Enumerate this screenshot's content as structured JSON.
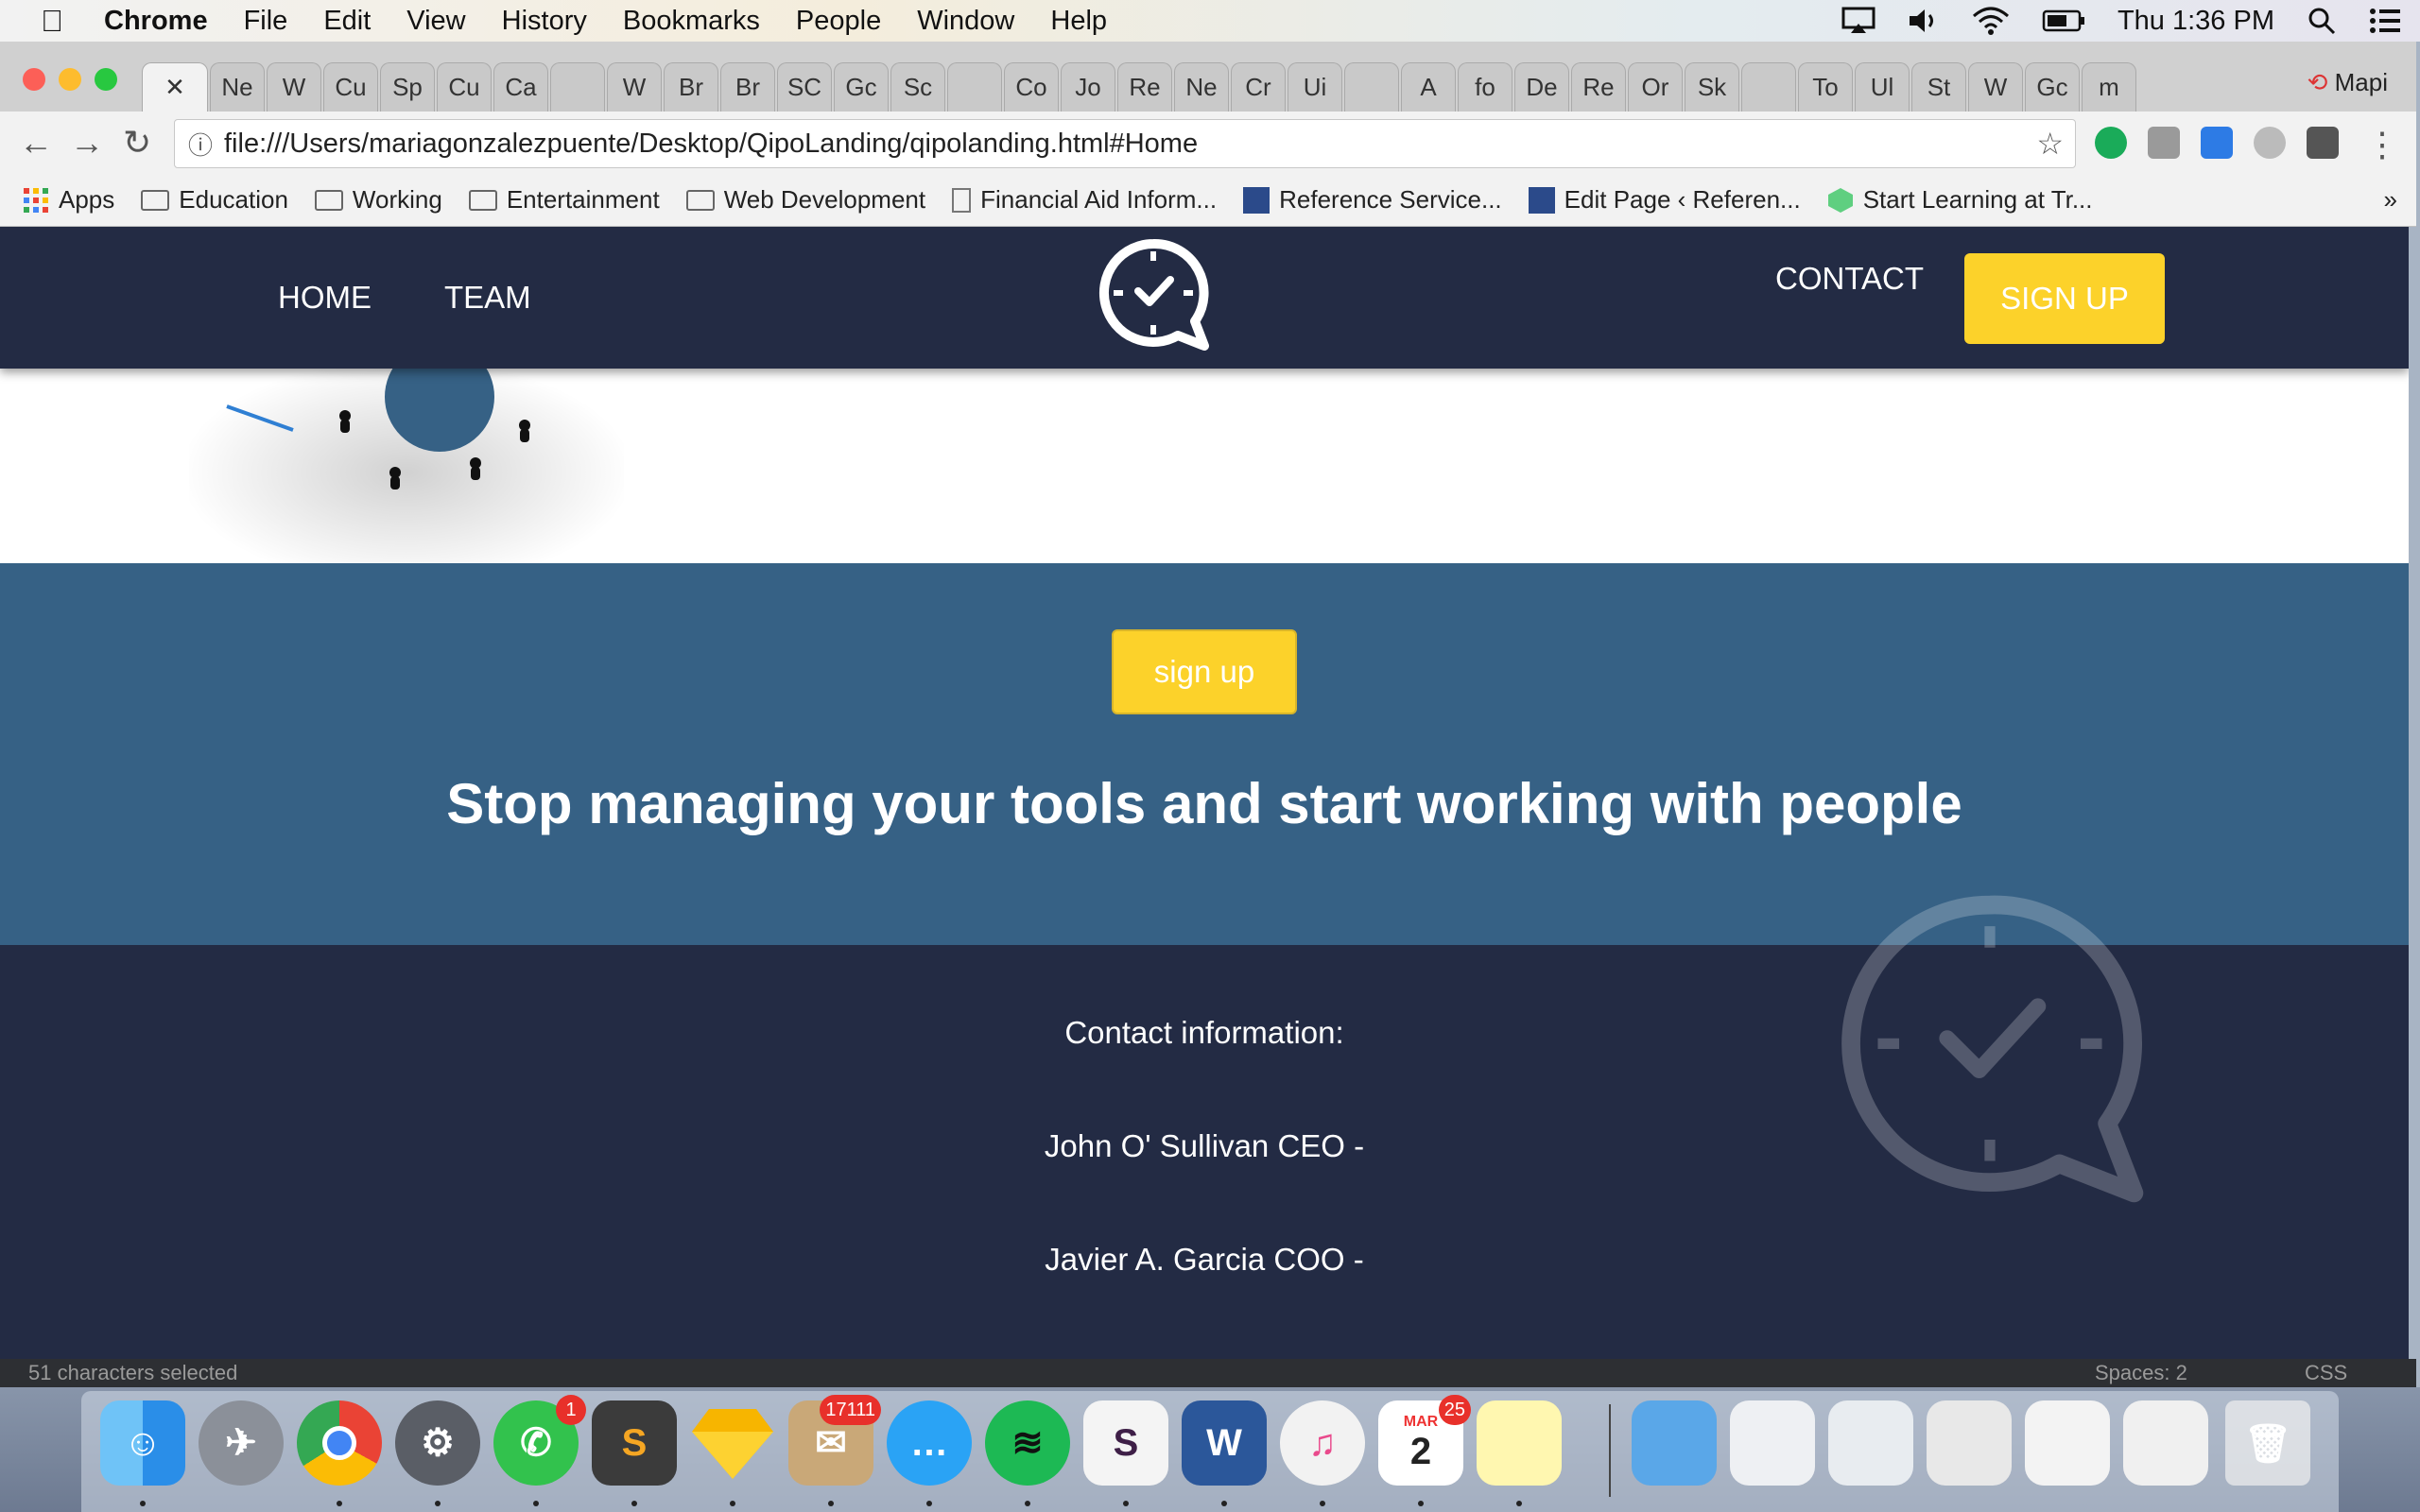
{
  "menubar": {
    "items": [
      "Chrome",
      "File",
      "Edit",
      "View",
      "History",
      "Bookmarks",
      "People",
      "Window",
      "Help"
    ],
    "clock": "Thu 1:36 PM"
  },
  "browser": {
    "tabs": [
      "Ne",
      "W",
      "Cu",
      "Sp",
      "Cu",
      "Ca",
      "",
      "W",
      "Br",
      "Br",
      "SC",
      "Gc",
      "Sc",
      "",
      "Co",
      "Jo",
      "Re",
      "Ne",
      "Cr",
      "Ui",
      "",
      "A",
      "fo",
      "De",
      "Re",
      "Or",
      "Sk",
      "",
      "To",
      "Ul",
      "St",
      "W",
      "Gc",
      "m"
    ],
    "profile": "Mapi",
    "url": "file:///Users/mariagonzalezpuente/Desktop/QipoLanding/qipolanding.html#Home",
    "bookmarks": [
      {
        "label": "Apps",
        "icon": "apps-grid-icon"
      },
      {
        "label": "Education",
        "icon": "folder-icon"
      },
      {
        "label": "Working",
        "icon": "folder-icon"
      },
      {
        "label": "Entertainment",
        "icon": "folder-icon"
      },
      {
        "label": "Web Development",
        "icon": "folder-icon"
      },
      {
        "label": "Financial Aid Inform...",
        "icon": "document-icon"
      },
      {
        "label": "Reference Service...",
        "icon": "grid-page-icon"
      },
      {
        "label": "Edit Page ‹ Referen...",
        "icon": "grid-page-icon"
      },
      {
        "label": "Start Learning at Tr...",
        "icon": "treehouse-icon"
      }
    ],
    "overflow": "»"
  },
  "site": {
    "nav": {
      "home": "HOME",
      "team": "TEAM",
      "contact": "CONTACT",
      "signup": "SIGN UP"
    },
    "cta": {
      "button": "sign up",
      "headline": "Stop managing your tools and start working with people"
    },
    "footer": {
      "heading": "Contact information:",
      "line1": "John O' Sullivan CEO -",
      "line2": "Javier A. Garcia COO -"
    },
    "colors": {
      "navy": "#232b44",
      "blue": "#366185",
      "yellow": "#fcd22a"
    }
  },
  "editor": {
    "status": "51 characters selected",
    "spaces": "Spaces: 2",
    "syntax": "CSS"
  },
  "dock": {
    "whatsapp_badge": "1",
    "mail_badge": "17111",
    "calendar_month": "MAR",
    "calendar_day": "2",
    "calendar_badge": "25"
  }
}
